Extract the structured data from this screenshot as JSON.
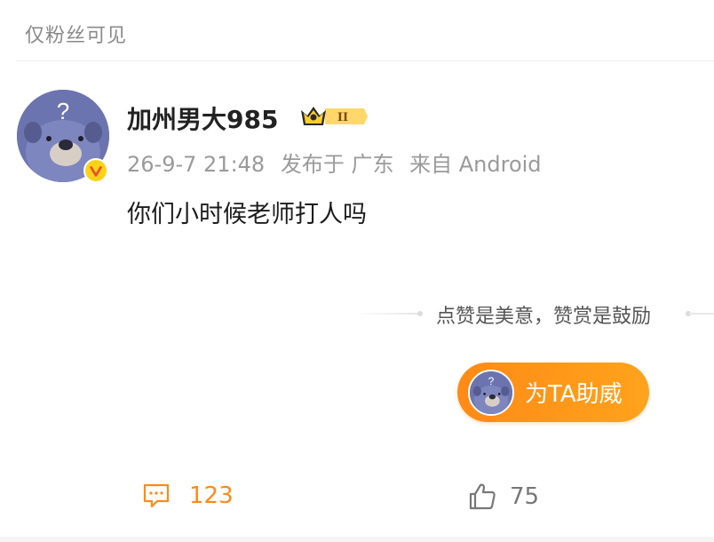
{
  "post": {
    "visibility": "仅粉丝可见",
    "author": {
      "name": "加州男大985",
      "badge_level": "II"
    },
    "time": "26-9-7 21:48",
    "location": "发布于 广东",
    "source": "来自 Android",
    "content": "你们小时候老师打人吗"
  },
  "reward": {
    "slogan": "点赞是美意，赞赏是鼓励",
    "button_label": "为TA助威"
  },
  "actions": {
    "comments": "123",
    "likes": "75"
  },
  "colors": {
    "accent": "#ff8a16",
    "verified": "#ffd21a"
  }
}
